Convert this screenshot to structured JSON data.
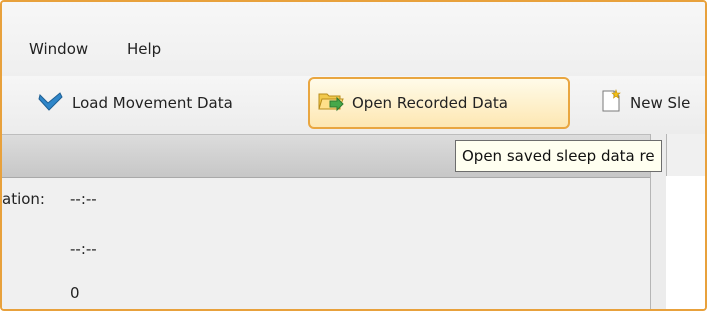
{
  "menu": {
    "items": [
      {
        "label": "Window"
      },
      {
        "label": "Help"
      }
    ]
  },
  "toolbar": {
    "buttons": [
      {
        "label": "Load Movement Data",
        "icon": "arrow-load-icon"
      },
      {
        "label": "Open Recorded Data",
        "icon": "folder-open-icon"
      },
      {
        "label": "New Sle",
        "icon": "new-document-icon"
      }
    ]
  },
  "tooltip": {
    "text": "Open saved sleep data re"
  },
  "panel": {
    "fields": [
      {
        "label": "ation:",
        "value": "--:--"
      },
      {
        "label": "",
        "value": "--:--"
      },
      {
        "label": "",
        "value": "0"
      }
    ]
  },
  "colors": {
    "highlight_border": "#e9a640",
    "highlight_fill": "#fde7b2",
    "arrow_blue": "#2f86c9",
    "folder_yellow": "#f2c94c",
    "folder_green": "#46a84a",
    "tooltip_bg": "#fffff0"
  }
}
